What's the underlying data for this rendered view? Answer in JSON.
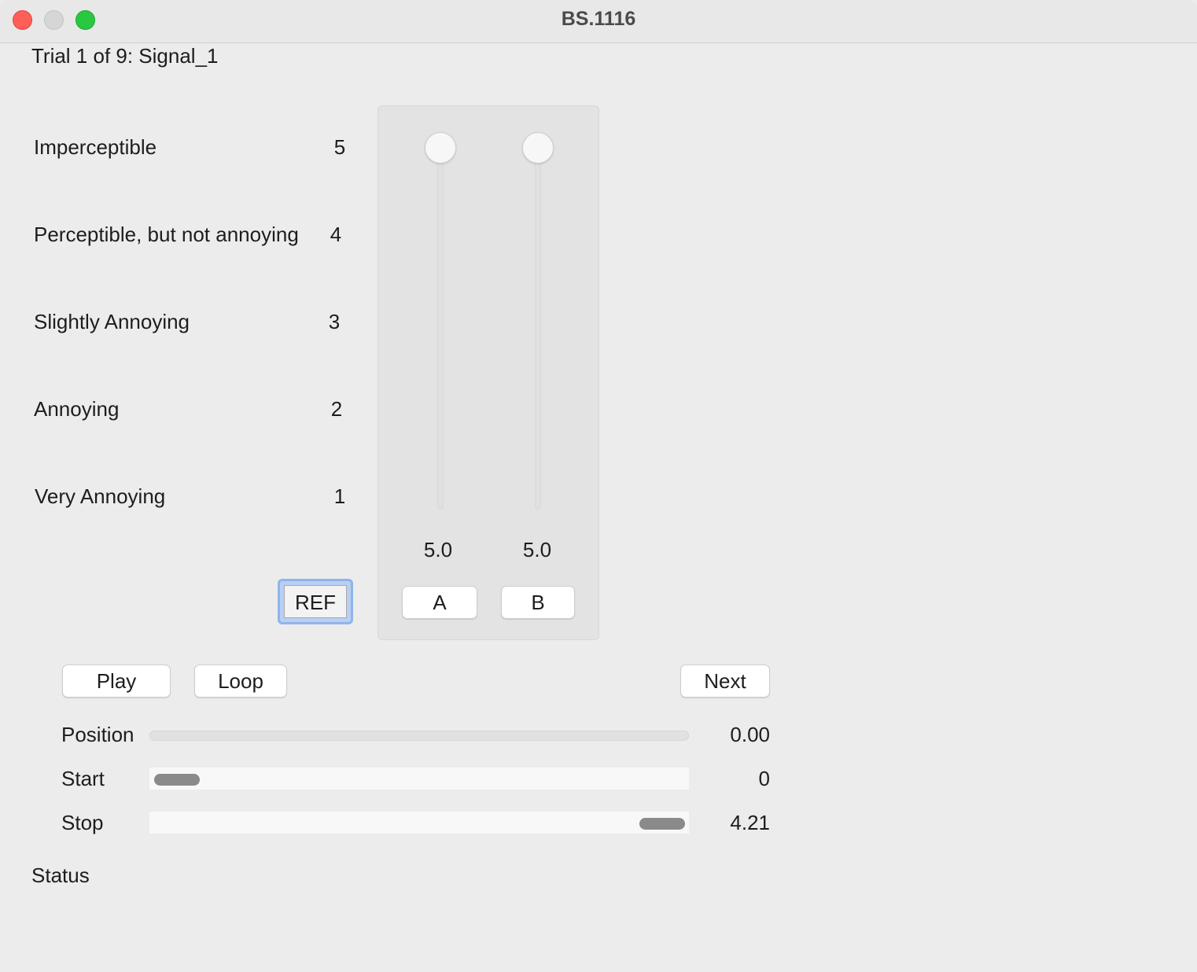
{
  "window": {
    "title": "BS.1116"
  },
  "trial": {
    "label": "Trial 1 of 9: Signal_1"
  },
  "scale": [
    {
      "label": "Imperceptible",
      "value": "5"
    },
    {
      "label": "Perceptible, but not annoying",
      "value": "4"
    },
    {
      "label": "Slightly Annoying",
      "value": "3"
    },
    {
      "label": "Annoying",
      "value": "2"
    },
    {
      "label": "Very Annoying",
      "value": "1"
    }
  ],
  "ratings": {
    "range": [
      1,
      5
    ],
    "a": {
      "label": "A",
      "value_text": "5.0",
      "value": 5.0
    },
    "b": {
      "label": "B",
      "value_text": "5.0",
      "value": 5.0
    }
  },
  "buttons": {
    "ref": "REF",
    "play": "Play",
    "loop": "Loop",
    "next": "Next"
  },
  "transport": {
    "position_label": "Position",
    "position_value": "0.00",
    "start_label": "Start",
    "start_value": "0",
    "stop_label": "Stop",
    "stop_value": "4.21"
  },
  "status": {
    "label": "Status"
  },
  "colors": {
    "background": "#ececec",
    "close": "#fe5f57",
    "zoom": "#28c840",
    "focus_ring": "#8fb4ea",
    "handle": "#8a8a8a"
  }
}
